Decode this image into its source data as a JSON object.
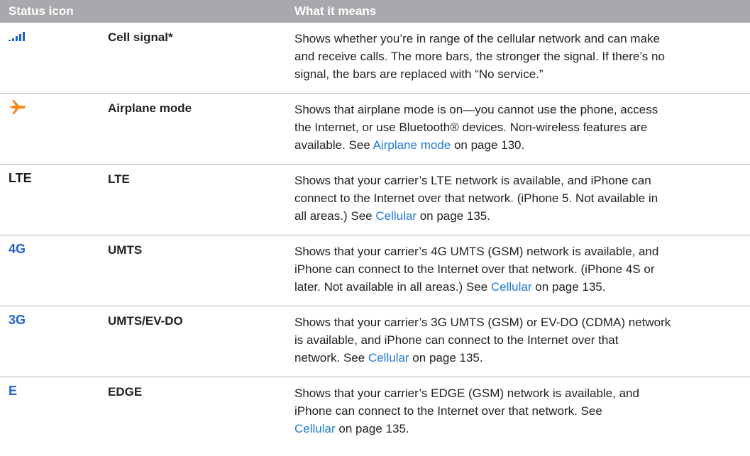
{
  "header": {
    "col_icon": "Status icon",
    "col_meaning": "What it means"
  },
  "colors": {
    "header_bg": "#a7a9ac",
    "link": "#1f7bd4",
    "icon_blue": "#1f62cf",
    "airplane_orange": "#f28b1e"
  },
  "rows": [
    {
      "icon_name": "cell-signal-icon",
      "name": "Cell signal*",
      "desc_line1": "Shows whether you’re in range of the cellular network and can make",
      "desc_line2": "and receive calls. The more bars, the stronger the signal. If there’s no",
      "desc_line3": "signal, the bars are replaced with “No service.”"
    },
    {
      "icon_name": "airplane-icon",
      "name": "Airplane mode",
      "desc_line1": "Shows that airplane mode is on—you cannot use the phone, access",
      "desc_line2": "the Internet, or use Bluetooth® devices. Non-wireless features are",
      "desc_pre": "available. See ",
      "link": "Airplane mode",
      "desc_post": " on page 130."
    },
    {
      "icon_name": "lte-icon",
      "icon_text": "LTE",
      "name": "LTE",
      "desc_line1": "Shows that your carrier’s LTE network is available, and iPhone can",
      "desc_line2": "connect to the Internet over that network. (iPhone 5. Not available in",
      "desc_pre": "all areas.) See ",
      "link": "Cellular",
      "desc_post": " on page 135."
    },
    {
      "icon_name": "4g-icon",
      "icon_text": "4G",
      "name": "UMTS",
      "desc_line1": "Shows that your carrier’s 4G UMTS (GSM) network is available, and",
      "desc_line2": "iPhone can connect to the Internet over that network. (iPhone 4S or",
      "desc_pre": "later. Not available in all areas.) See ",
      "link": "Cellular",
      "desc_post": " on page 135."
    },
    {
      "icon_name": "3g-icon",
      "icon_text": "3G",
      "name": "UMTS/EV-DO",
      "desc_line1": "Shows that your carrier’s 3G UMTS (GSM) or EV-DO (CDMA) network",
      "desc_line2": "is available, and iPhone can connect to the Internet over that",
      "desc_pre": "network. See ",
      "link": "Cellular",
      "desc_post": " on page 135."
    },
    {
      "icon_name": "edge-icon",
      "icon_text": "E",
      "name": "EDGE",
      "desc_line1": "Shows that your carrier’s EDGE (GSM) network is available, and",
      "desc_line2": "iPhone can connect to the Internet over that network. See",
      "desc_pre": "",
      "link": "Cellular",
      "desc_post": " on page 135."
    }
  ]
}
